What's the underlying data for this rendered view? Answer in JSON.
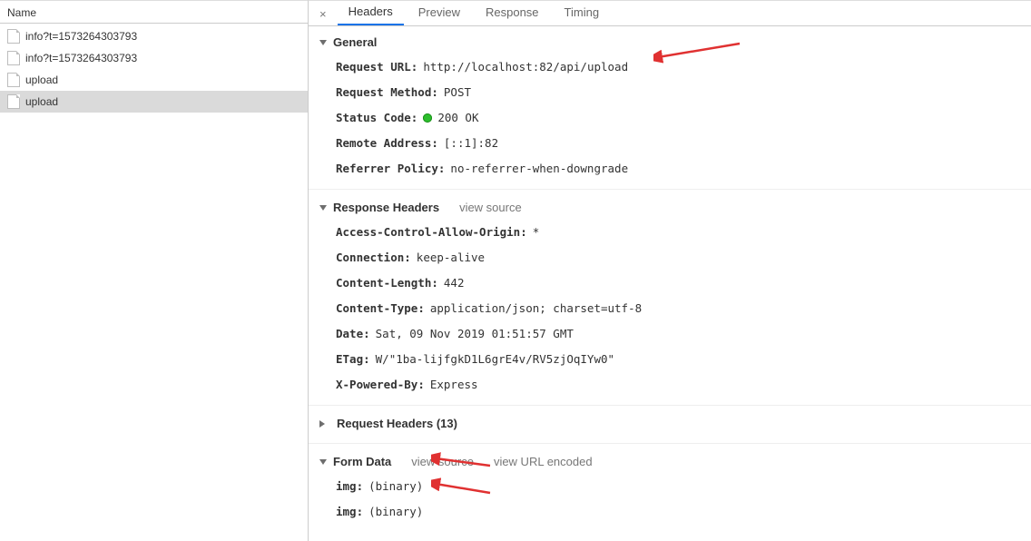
{
  "left": {
    "header": "Name",
    "rows": [
      {
        "label": "info?t=1573264303793",
        "selected": false
      },
      {
        "label": "info?t=1573264303793",
        "selected": false
      },
      {
        "label": "upload",
        "selected": false
      },
      {
        "label": "upload",
        "selected": true
      }
    ]
  },
  "tabs": {
    "close": "×",
    "items": [
      "Headers",
      "Preview",
      "Response",
      "Timing"
    ],
    "active": 0
  },
  "sections": {
    "general": {
      "title": "General",
      "request_url_label": "Request URL",
      "request_url_value": "http://localhost:82/api/upload",
      "request_method_label": "Request Method",
      "request_method_value": "POST",
      "status_code_label": "Status Code",
      "status_code_value": "200 OK",
      "remote_address_label": "Remote Address",
      "remote_address_value": "[::1]:82",
      "referrer_policy_label": "Referrer Policy",
      "referrer_policy_value": "no-referrer-when-downgrade"
    },
    "response_headers": {
      "title": "Response Headers",
      "view_source": "view source",
      "items": [
        {
          "k": "Access-Control-Allow-Origin",
          "v": "*"
        },
        {
          "k": "Connection",
          "v": "keep-alive"
        },
        {
          "k": "Content-Length",
          "v": "442"
        },
        {
          "k": "Content-Type",
          "v": "application/json; charset=utf-8"
        },
        {
          "k": "Date",
          "v": "Sat, 09 Nov 2019 01:51:57 GMT"
        },
        {
          "k": "ETag",
          "v": "W/\"1ba-lijfgkD1L6grE4v/RV5zjOqIYw0\""
        },
        {
          "k": "X-Powered-By",
          "v": "Express"
        }
      ]
    },
    "request_headers": {
      "title": "Request Headers (13)"
    },
    "form_data": {
      "title": "Form Data",
      "view_source": "view source",
      "view_url_encoded": "view URL encoded",
      "items": [
        {
          "k": "img",
          "v": "(binary)"
        },
        {
          "k": "img",
          "v": "(binary)"
        }
      ]
    }
  }
}
